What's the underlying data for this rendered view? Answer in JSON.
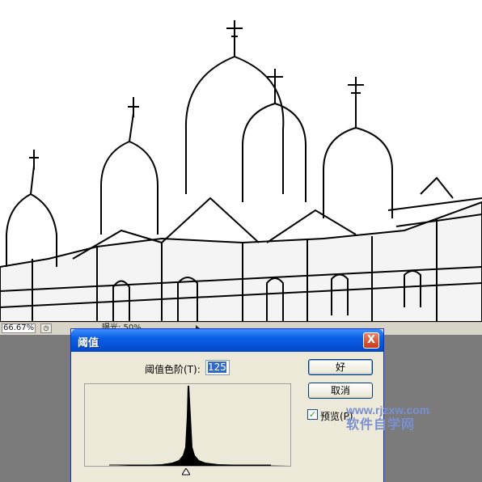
{
  "status_bar": {
    "zoom": "66.67%",
    "doc_info": "曝光: 50%"
  },
  "dialog": {
    "title": "阈值",
    "close_label": "X",
    "level_label": "阈值色阶(T):",
    "level_value": "125",
    "ok_label": "好",
    "cancel_label": "取消",
    "preview_label": "预览(P)",
    "preview_checked": true
  },
  "watermark": {
    "line1": "www.rjzxw.com",
    "line2": "软件自学网"
  },
  "colors": {
    "titlebar": "#0a5fe5",
    "dialog_bg": "#ece9d8",
    "workspace_bg": "#7b7b7b"
  }
}
